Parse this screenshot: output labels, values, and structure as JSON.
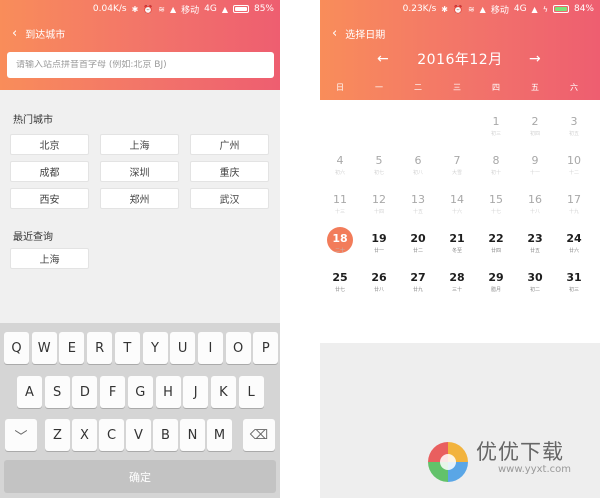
{
  "left": {
    "status": {
      "speed": "0.04K/s",
      "carrier": "移动",
      "network": "4G",
      "battery": "85%"
    },
    "title": "到达城市",
    "search": {
      "placeholder": "请输入站点拼音首字母 (例如:北京 BJ)",
      "value": ""
    },
    "hot_title": "热门城市",
    "hot_cities": [
      "北京",
      "上海",
      "广州",
      "成都",
      "深圳",
      "重庆",
      "西安",
      "郑州",
      "武汉"
    ],
    "recent_title": "最近查询",
    "recent": [
      "上海"
    ],
    "keyboard": {
      "row1": [
        "Q",
        "W",
        "E",
        "R",
        "T",
        "Y",
        "U",
        "I",
        "O",
        "P"
      ],
      "row2": [
        "A",
        "S",
        "D",
        "F",
        "G",
        "H",
        "J",
        "K",
        "L"
      ],
      "row3": [
        "Z",
        "X",
        "C",
        "V",
        "B",
        "N",
        "M"
      ],
      "confirm": "确定"
    }
  },
  "right": {
    "status": {
      "speed": "0.23K/s",
      "carrier": "移动",
      "network": "4G",
      "battery": "84%"
    },
    "title": "选择日期",
    "month": "2016年12月",
    "weekdays": [
      "日",
      "一",
      "二",
      "三",
      "四",
      "五",
      "六"
    ],
    "days": [
      {
        "n": "1",
        "l": "初三"
      },
      {
        "n": "2",
        "l": "初四"
      },
      {
        "n": "3",
        "l": "初五"
      },
      {
        "n": "4",
        "l": "初六"
      },
      {
        "n": "5",
        "l": "初七"
      },
      {
        "n": "6",
        "l": "初八"
      },
      {
        "n": "7",
        "l": "大雪"
      },
      {
        "n": "8",
        "l": "初十"
      },
      {
        "n": "9",
        "l": "十一"
      },
      {
        "n": "10",
        "l": "十二"
      },
      {
        "n": "11",
        "l": "十三"
      },
      {
        "n": "12",
        "l": "十四"
      },
      {
        "n": "13",
        "l": "十五"
      },
      {
        "n": "14",
        "l": "十六"
      },
      {
        "n": "15",
        "l": "十七"
      },
      {
        "n": "16",
        "l": "十八"
      },
      {
        "n": "17",
        "l": "十九"
      },
      {
        "n": "18",
        "l": "二十"
      },
      {
        "n": "19",
        "l": "廿一"
      },
      {
        "n": "20",
        "l": "廿二"
      },
      {
        "n": "21",
        "l": "冬至"
      },
      {
        "n": "22",
        "l": "廿四"
      },
      {
        "n": "23",
        "l": "廿五"
      },
      {
        "n": "24",
        "l": "廿六"
      },
      {
        "n": "25",
        "l": "廿七"
      },
      {
        "n": "26",
        "l": "廿八"
      },
      {
        "n": "27",
        "l": "廿九"
      },
      {
        "n": "28",
        "l": "三十"
      },
      {
        "n": "29",
        "l": "腊月"
      },
      {
        "n": "30",
        "l": "初二"
      },
      {
        "n": "31",
        "l": "初三"
      }
    ],
    "first_weekday": 4,
    "today": "18"
  },
  "watermark": {
    "title": "优优下载",
    "url": "www.yyxt.com"
  },
  "colors": {
    "accent_start": "#f98d5a",
    "accent_end": "#ee5e70",
    "today": "#f27c5a"
  }
}
